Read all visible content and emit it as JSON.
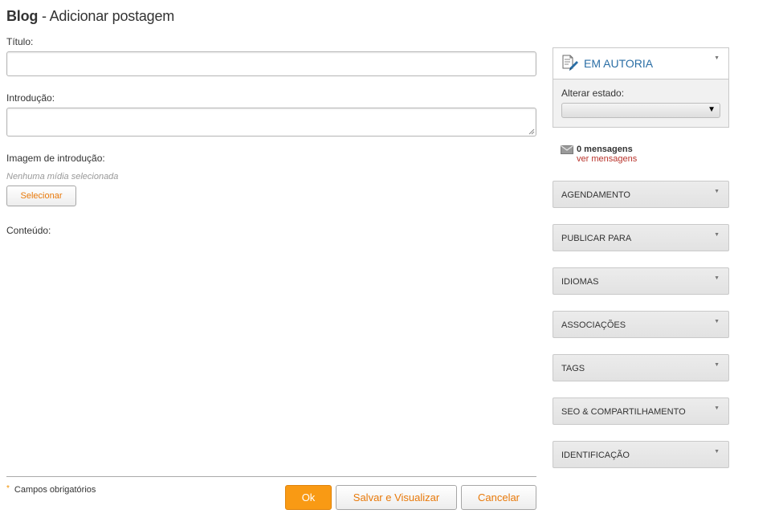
{
  "header": {
    "module": "Blog",
    "separator": " - ",
    "title": "Adicionar postagem"
  },
  "form": {
    "title_label": "Título:",
    "title_value": "",
    "intro_label": "Introdução:",
    "intro_value": "",
    "image_label": "Imagem de introdução:",
    "image_hint": "Nenhuma mídia selecionada",
    "select_button": "Selecionar",
    "content_label": "Conteúdo:"
  },
  "footer": {
    "required_mark": "*",
    "required_note": "Campos obrigatórios",
    "ok_button": "Ok",
    "save_view_button": "Salvar e Visualizar",
    "cancel_button": "Cancelar"
  },
  "sidebar": {
    "status_panel": {
      "title": "EM AUTORIA",
      "icon": "document-edit-icon",
      "state_label": "Alterar estado:",
      "state_value": ""
    },
    "messages": {
      "icon": "envelope-icon",
      "count_text": "0 mensagens",
      "link_text": "ver mensagens"
    },
    "panels": [
      {
        "label": "AGENDAMENTO"
      },
      {
        "label": "PUBLICAR PARA"
      },
      {
        "label": "IDIOMAS"
      },
      {
        "label": "ASSOCIAÇÕES"
      },
      {
        "label": "TAGS"
      },
      {
        "label": "SEO & COMPARTILHAMENTO"
      },
      {
        "label": "IDENTIFICAÇÃO"
      }
    ]
  },
  "colors": {
    "accent": "#f99a14",
    "link": "#b8332b",
    "status_title": "#2a6ea5"
  }
}
